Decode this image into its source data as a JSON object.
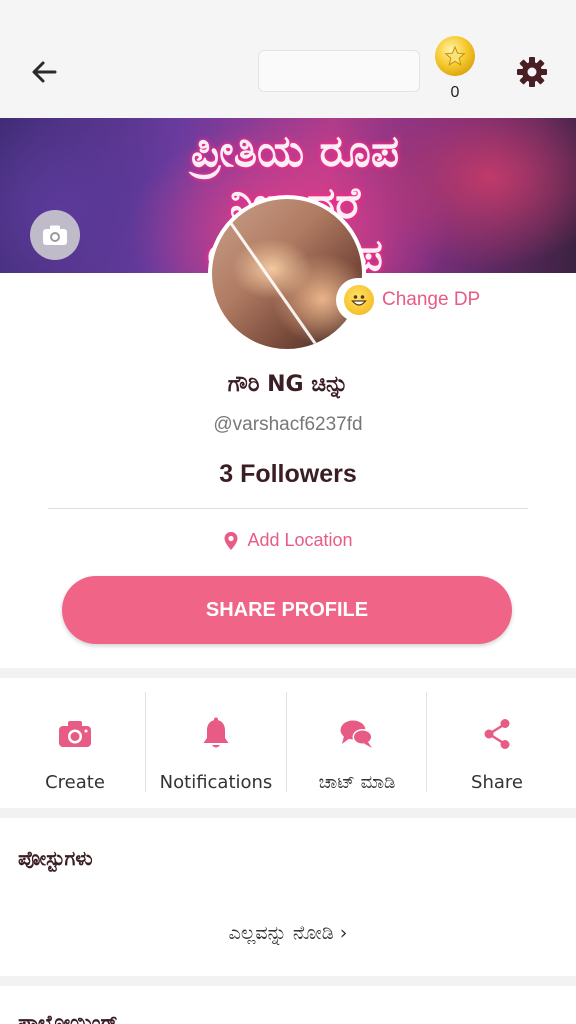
{
  "colors": {
    "accent": "#f06488",
    "pink_text": "#e85b84",
    "dark_text": "#3a1e23"
  },
  "header": {
    "coin_count": "0"
  },
  "cover": {
    "text_lines": [
      "ಪ್ರೀತಿಯ ರೂಪ",
      "ನೀನಾದರೆ",
      "ಅದರ ರೂಪ"
    ]
  },
  "profile": {
    "change_dp_label": "Change DP",
    "name": "ಗೌರಿ NG ಚಿನ್ನು",
    "handle": "@varshacf6237fd",
    "followers": "3 Followers",
    "location_label": "Add Location",
    "share_button": "SHARE PROFILE"
  },
  "actions": [
    {
      "label": "Create",
      "icon": "camera-icon"
    },
    {
      "label": "Notifications",
      "icon": "bell-icon"
    },
    {
      "label": "ಚಾಟ್ ಮಾಡಿ",
      "icon": "chat-icon"
    },
    {
      "label": "Share",
      "icon": "share-icon"
    }
  ],
  "posts": {
    "title": "ಪೋಸ್ಟುಗಳು",
    "see_all": "ಎಲ್ಲವನ್ನು ನೋಡಿ ›"
  },
  "next_section": {
    "title": "ಪಾಲೋಯಿಂಗ್"
  }
}
